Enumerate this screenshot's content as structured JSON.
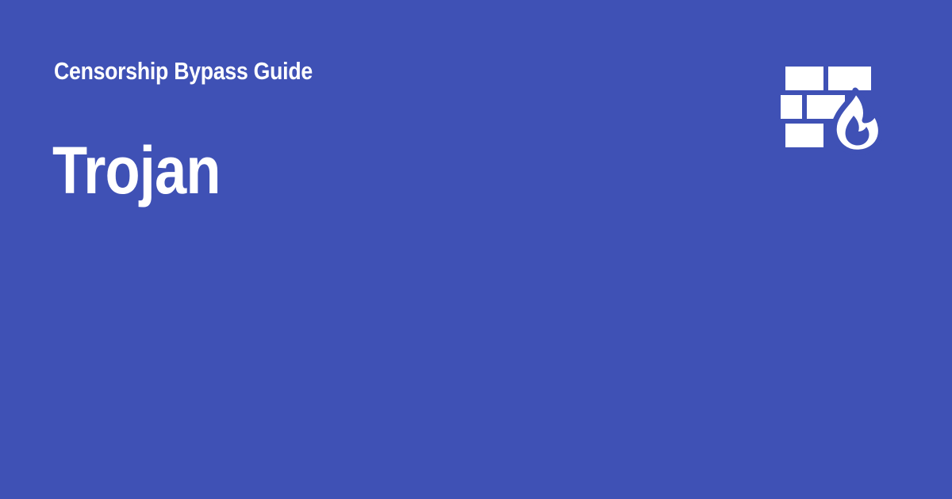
{
  "header": {
    "site_name": "Censorship Bypass Guide",
    "logo_icon": "firewall-icon"
  },
  "main": {
    "title": "Trojan"
  },
  "colors": {
    "background": "#3f51b5",
    "foreground": "#ffffff"
  }
}
